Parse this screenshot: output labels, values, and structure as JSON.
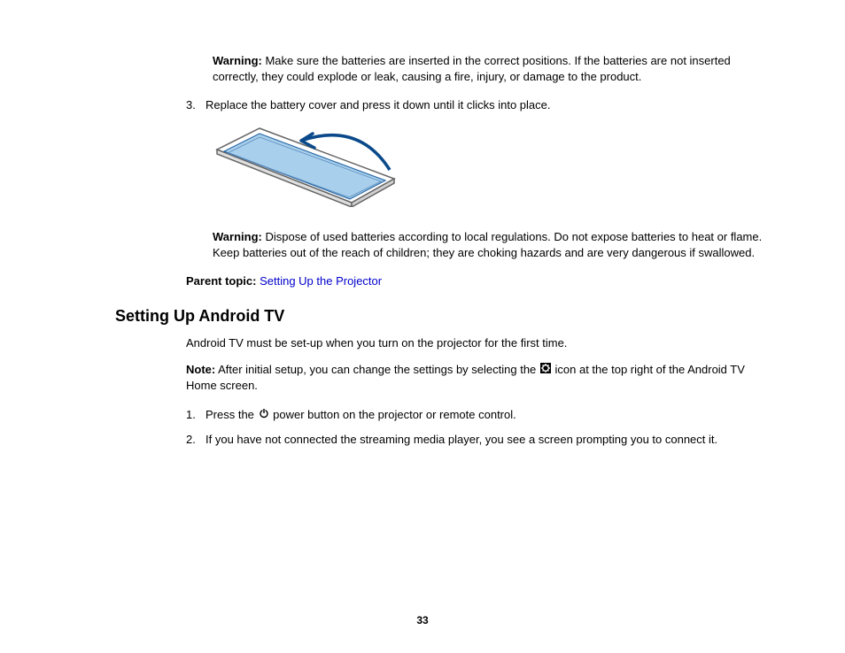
{
  "warning1": {
    "label": "Warning:",
    "text": " Make sure the batteries are inserted in the correct positions. If the batteries are not inserted correctly, they could explode or leak, causing a fire, injury, or damage to the product."
  },
  "step3": {
    "num": "3.",
    "text": "Replace the battery cover and press it down until it clicks into place."
  },
  "warning2": {
    "label": "Warning:",
    "text": " Dispose of used batteries according to local regulations. Do not expose batteries to heat or flame. Keep batteries out of the reach of children; they are choking hazards and are very dangerous if swallowed."
  },
  "parentTopic": {
    "label": "Parent topic:",
    "link": " Setting Up the Projector"
  },
  "heading": "Setting Up Android TV",
  "intro": "Android TV must be set-up when you turn on the projector for the first time.",
  "note": {
    "label": "Note:",
    "textBefore": " After initial setup, you can change the settings by selecting the ",
    "textAfter": " icon at the top right of the Android TV Home screen."
  },
  "step1": {
    "num": "1.",
    "textBefore": "Press the ",
    "textAfter": " power button on the projector or remote control."
  },
  "step2": {
    "num": "2.",
    "text": "If you have not connected the streaming media player, you see a screen prompting you to connect it."
  },
  "pageNumber": "33"
}
